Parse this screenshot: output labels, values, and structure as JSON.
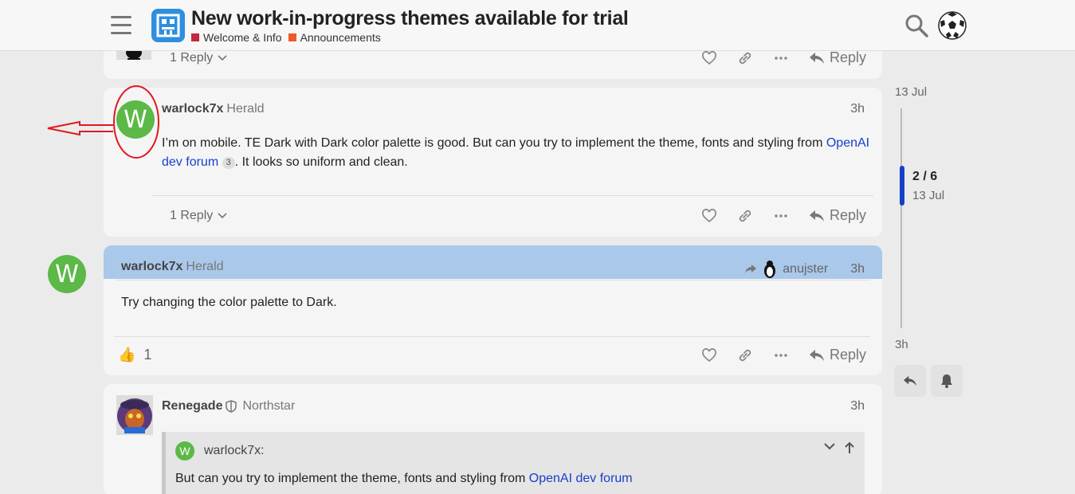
{
  "header": {
    "title": "New work-in-progress themes available for trial",
    "categories": [
      {
        "label": "Welcome & Info",
        "color": "#c5283d"
      },
      {
        "label": "Announcements",
        "color": "#f05a28"
      }
    ]
  },
  "posts": {
    "top": {
      "replies_label": "1 Reply",
      "reply_label": "Reply"
    },
    "second": {
      "avatar_letter": "W",
      "username": "warlock7x",
      "user_title": "Herald",
      "time": "3h",
      "body_text": "I’m on mobile. TE Dark with Dark color palette is good. But can you try to implement the theme, fonts and styling from",
      "link_text": "OpenAI dev forum",
      "link_count": "3",
      "body_text_after": ". It looks so uniform and clean.",
      "replies_label": "1 Reply",
      "reply_label": "Reply"
    },
    "third": {
      "avatar_letter": "W",
      "username": "warlock7x",
      "user_title": "Herald",
      "reply_to_user": "anujster",
      "time": "3h",
      "body_text": "Try changing the color palette to Dark.",
      "reaction_count": "1",
      "reply_label": "Reply"
    },
    "fourth": {
      "username": "Renegade",
      "user_title": "Northstar",
      "time": "3h",
      "quote_avatar_letter": "W",
      "quote_user": "warlock7x:",
      "quote_text": "But can you try to implement the theme, fonts and styling from",
      "quote_link": "OpenAI dev forum"
    }
  },
  "timeline": {
    "start_date": "13 Jul",
    "position": "2 / 6",
    "position_date": "13 Jul",
    "end_label": "3h"
  },
  "colors": {
    "accent": "#1740c9",
    "avatar_green": "#5cb847",
    "highlight": "#a9c8ea",
    "annotation_red": "#e0191f"
  }
}
